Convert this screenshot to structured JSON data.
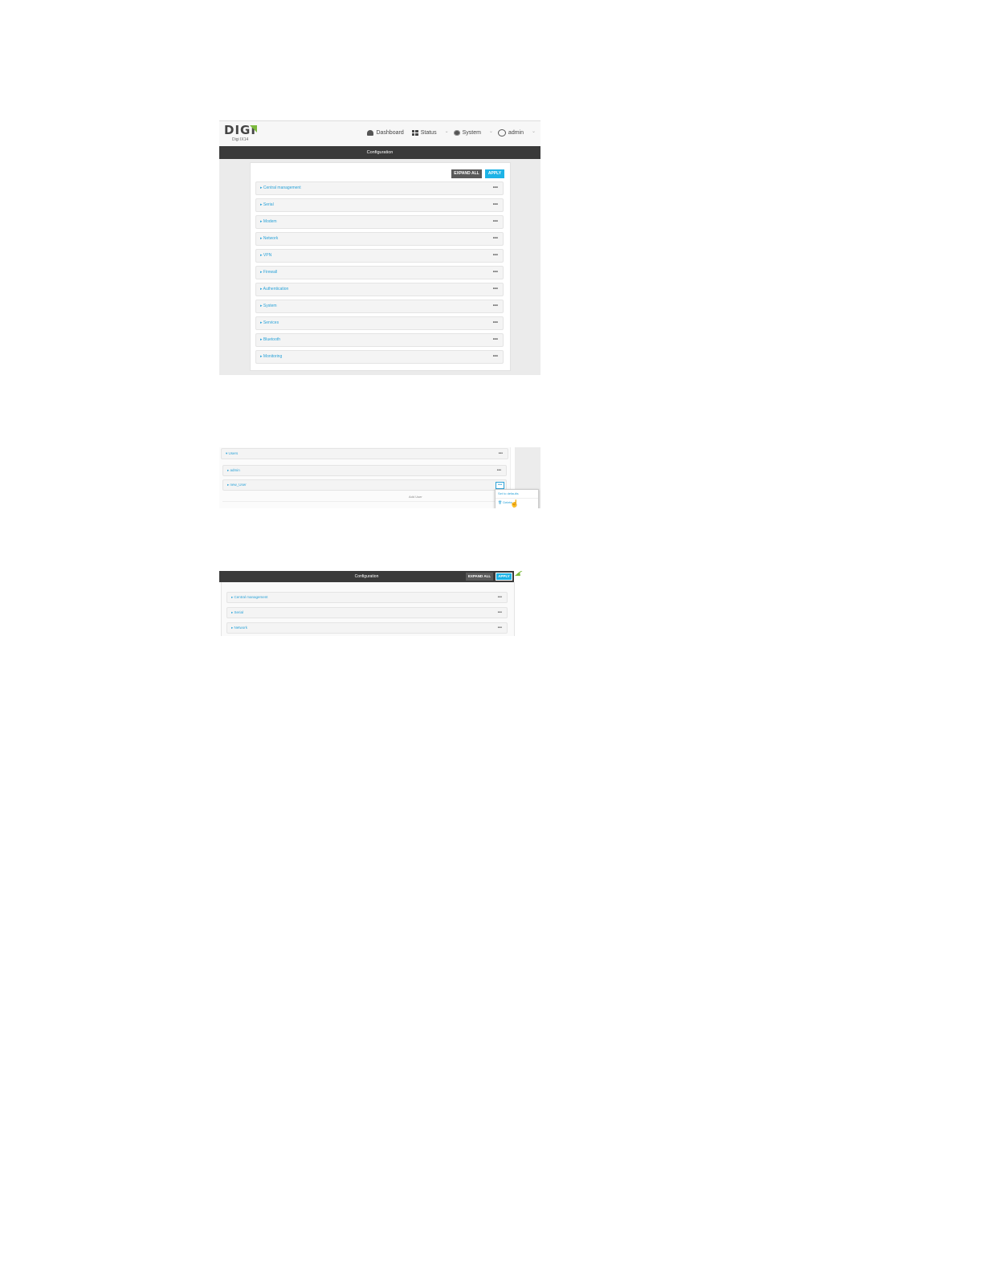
{
  "shot1": {
    "logo": {
      "brand": "DIGI",
      "subtitle": "Digi IX14"
    },
    "nav": [
      {
        "label": "Dashboard",
        "icon": "dashboard-icon"
      },
      {
        "label": "Status",
        "icon": "grid-icon"
      },
      {
        "label": "System",
        "icon": "gear-icon"
      },
      {
        "label": "admin",
        "icon": "user-icon"
      }
    ],
    "bar_title": "Configuration",
    "expand_all": "EXPAND ALL",
    "apply": "APPLY",
    "sections": [
      "▸ Central management",
      "▸ Serial",
      "▸ Modem",
      "▸ Network",
      "▸ VPN",
      "▸ Firewall",
      "▸ Authentication",
      "▸ System",
      "▸ Services",
      "▸ Bluetooth",
      "▸ Monitoring"
    ],
    "row_menu": "•••"
  },
  "shot2": {
    "group": "▾ Users",
    "rows": [
      "▸ admin",
      "▸ new_User"
    ],
    "row_menu": "•••",
    "field_label": "Add User",
    "menu_items": [
      "Set to defaults",
      "🗑 Delete"
    ],
    "cursor": "☝"
  },
  "shot3": {
    "bar_title": "Configuration",
    "expand_all": "EXPAND ALL",
    "apply": "APPLY",
    "sections": [
      "▸ Central management",
      "▸ Serial",
      "▸ Network"
    ],
    "row_menu": "•••",
    "arrow_color": "#7cba3d",
    "accent_color": "#1db3e6"
  }
}
